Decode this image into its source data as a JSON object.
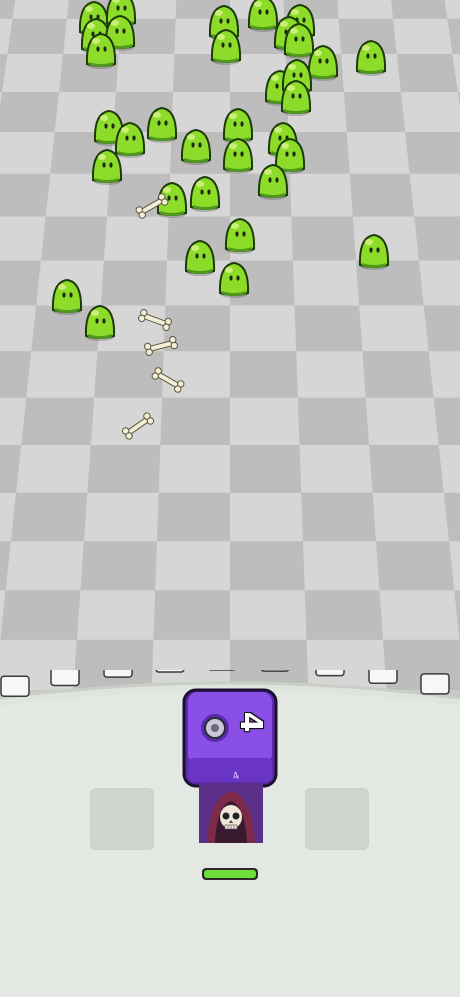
{
  "board": {
    "tile_light": "#d6d6d6",
    "tile_dark": "#bdbdbd",
    "enemy_type": "green-slime",
    "enemy_color": "#8edc2a",
    "projectile_type": "bone"
  },
  "wall": {
    "color": "#e3e7e1",
    "crenellation_color": "#f7f7f5"
  },
  "player_unit": {
    "dice_color": "#7b3fd6",
    "dice_value": "4",
    "character": "grim-reaper",
    "health_fraction": 1.0,
    "health_color": "#6fe03a"
  },
  "empty_slots": 2
}
